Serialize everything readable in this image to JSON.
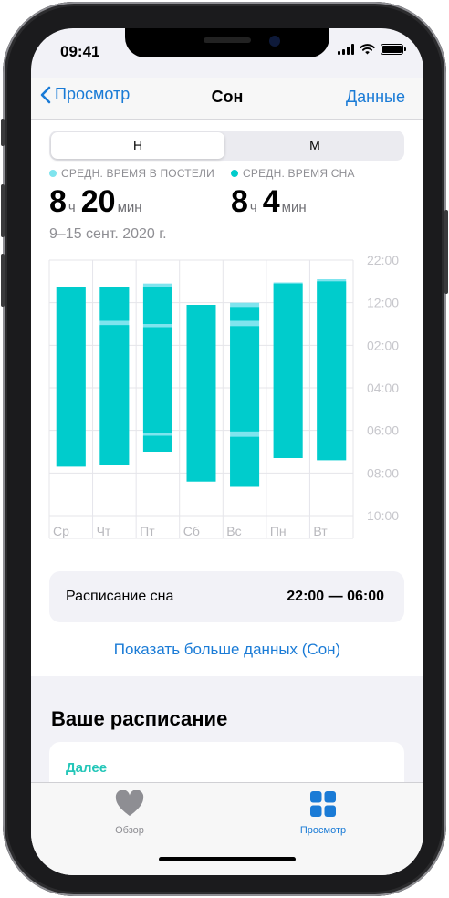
{
  "status": {
    "time": "09:41"
  },
  "nav": {
    "back_label": "Просмотр",
    "title": "Сон",
    "right_label": "Данные"
  },
  "segments": {
    "active": "Н",
    "inactive": "М"
  },
  "legend": [
    {
      "label": "СРЕДН. ВРЕМЯ В ПОСТЕЛИ",
      "color": "#7fe4ee"
    },
    {
      "label": "СРЕДН. ВРЕМЯ СНА",
      "color": "#00cccc"
    }
  ],
  "stats": {
    "in_bed": {
      "hours": "8",
      "hours_unit": "ч",
      "minutes": "20",
      "minutes_unit": "мин"
    },
    "asleep": {
      "hours": "8",
      "hours_unit": "ч",
      "minutes": "4",
      "minutes_unit": "мин"
    }
  },
  "date_range": "9–15 сент. 2020 г.",
  "chart_data": {
    "type": "bar",
    "categories": [
      "Ср",
      "Чт",
      "Пт",
      "Сб",
      "Вс",
      "Пн",
      "Вт"
    ],
    "y_ticks": [
      "22:00",
      "12:00",
      "02:00",
      "04:00",
      "06:00",
      "08:00",
      "10:00"
    ],
    "y_axis": "hours after 22:00 (labels as printed)",
    "ylim": [
      0,
      12
    ],
    "series": [
      {
        "name": "СРЕДН. ВРЕМЯ В ПОСТЕЛИ",
        "color": "#7fe4ee",
        "intervals": [
          [
            1.25,
            9.7
          ],
          [
            1.25,
            9.6
          ],
          [
            1.1,
            9.0
          ],
          [
            2.1,
            10.4
          ],
          [
            2.0,
            10.65
          ],
          [
            1.05,
            9.3
          ],
          [
            0.9,
            9.4
          ]
        ]
      },
      {
        "name": "СРЕДН. ВРЕМЯ СНА",
        "color": "#00cccc",
        "segments": [
          [
            [
              1.25,
              9.7
            ]
          ],
          [
            [
              1.25,
              2.85
            ],
            [
              3.05,
              9.6
            ]
          ],
          [
            [
              1.25,
              3.0
            ],
            [
              3.15,
              8.1
            ],
            [
              8.25,
              9.0
            ]
          ],
          [
            [
              2.1,
              10.4
            ]
          ],
          [
            [
              2.2,
              2.85
            ],
            [
              3.1,
              8.05
            ],
            [
              8.3,
              10.65
            ]
          ],
          [
            [
              1.1,
              9.3
            ]
          ],
          [
            [
              1.0,
              9.4
            ]
          ]
        ]
      }
    ],
    "grid": true
  },
  "schedule": {
    "label": "Расписание сна",
    "value": "22:00 — 06:00"
  },
  "more_link": "Показать больше данных (Сон)",
  "your_schedule": {
    "title": "Ваше расписание",
    "next_label": "Далее"
  },
  "tabs": [
    {
      "label": "Обзор",
      "icon": "heart-icon",
      "active": false
    },
    {
      "label": "Просмотр",
      "icon": "grid-icon",
      "active": true
    }
  ],
  "colors": {
    "accent": "#1a7bd6",
    "sleep": "#00cccc",
    "in_bed": "#7fe4ee",
    "next": "#23c6b8"
  }
}
